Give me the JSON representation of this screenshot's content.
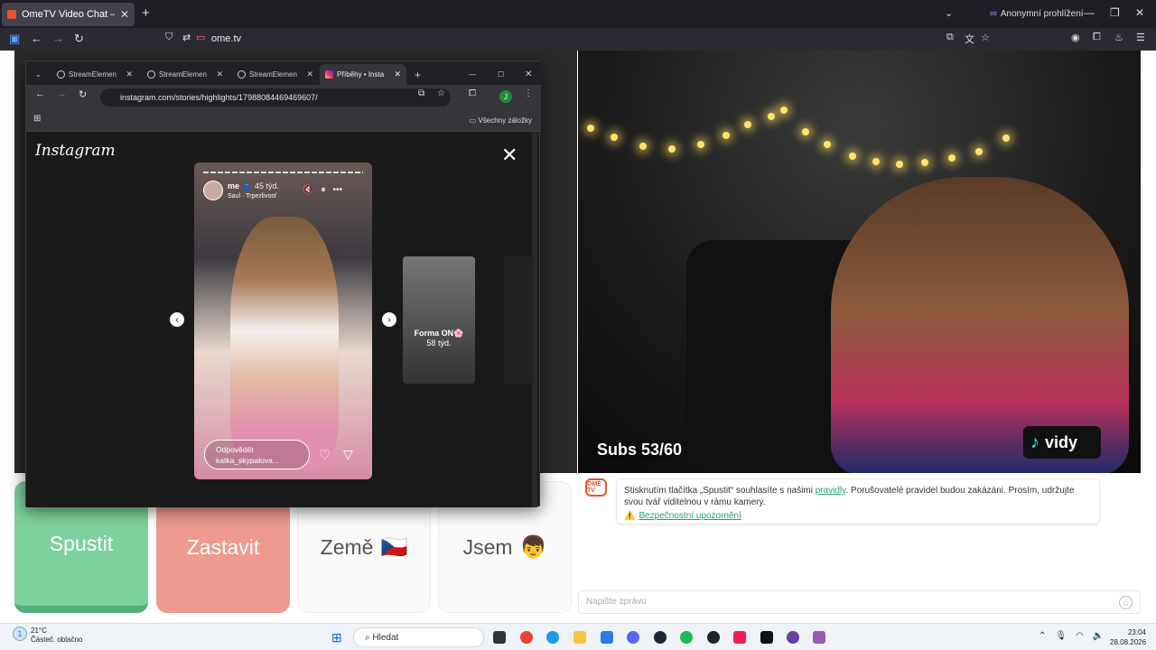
{
  "browser": {
    "tab_title": "OmeTV Video Chat — Omegle",
    "new_tab_symbol": "+",
    "private_label": "Anonymní prohlížení",
    "url": "ome.tv"
  },
  "chrome": {
    "tabs": [
      {
        "label": "StreamElemen"
      },
      {
        "label": "StreamElemen"
      },
      {
        "label": "StreamElemen"
      },
      {
        "label": "Příběhy • Insta"
      }
    ],
    "url": "instagram.com/stories/highlights/17988084469469607/",
    "bookmarks_label": "Všechny záložky",
    "profile_letter": "J"
  },
  "instagram": {
    "logo": "Instagram",
    "story": {
      "username": "me 👗",
      "age": "45 týd.",
      "music": "Saul · Trpezlivosť",
      "reply_placeholder": "Odpovědět katka_skypalova..."
    },
    "next_story": {
      "title": "Forma ON🌸",
      "age": "58 týd."
    }
  },
  "stream": {
    "subs": "Subs 53/60",
    "tiktok_label": "vidy"
  },
  "controls": {
    "start": "Spustit",
    "stop": "Zastavit",
    "country": "Země",
    "country_flag": "🇨🇿",
    "gender": "Jsem",
    "gender_emoji": "👦"
  },
  "chat": {
    "logo_text": "OME TV",
    "notice_pre": "Stisknutím tlačítka „Spustit“ souhlasíte s našimi ",
    "notice_link": "pravidly",
    "notice_post": ". Porušovatelé pravidel budou zakázáni. Prosím, udržujte svou tvář viditelnou v rámu kamery.",
    "warning_link": "Bezpečnostní upozornění",
    "input_placeholder": "Napište zprávu"
  },
  "taskbar": {
    "weather_temp": "21°C",
    "weather_desc": "Částeč. oblačno",
    "weather_badge": "1",
    "search_label": "Hledat",
    "time": "23:04",
    "date": "28.08.2026"
  },
  "colors": {
    "start_button": "#7dd19d",
    "stop_button": "#ee9a8f",
    "link_green": "#2a9e6c",
    "ome_orange": "#e8542d"
  }
}
